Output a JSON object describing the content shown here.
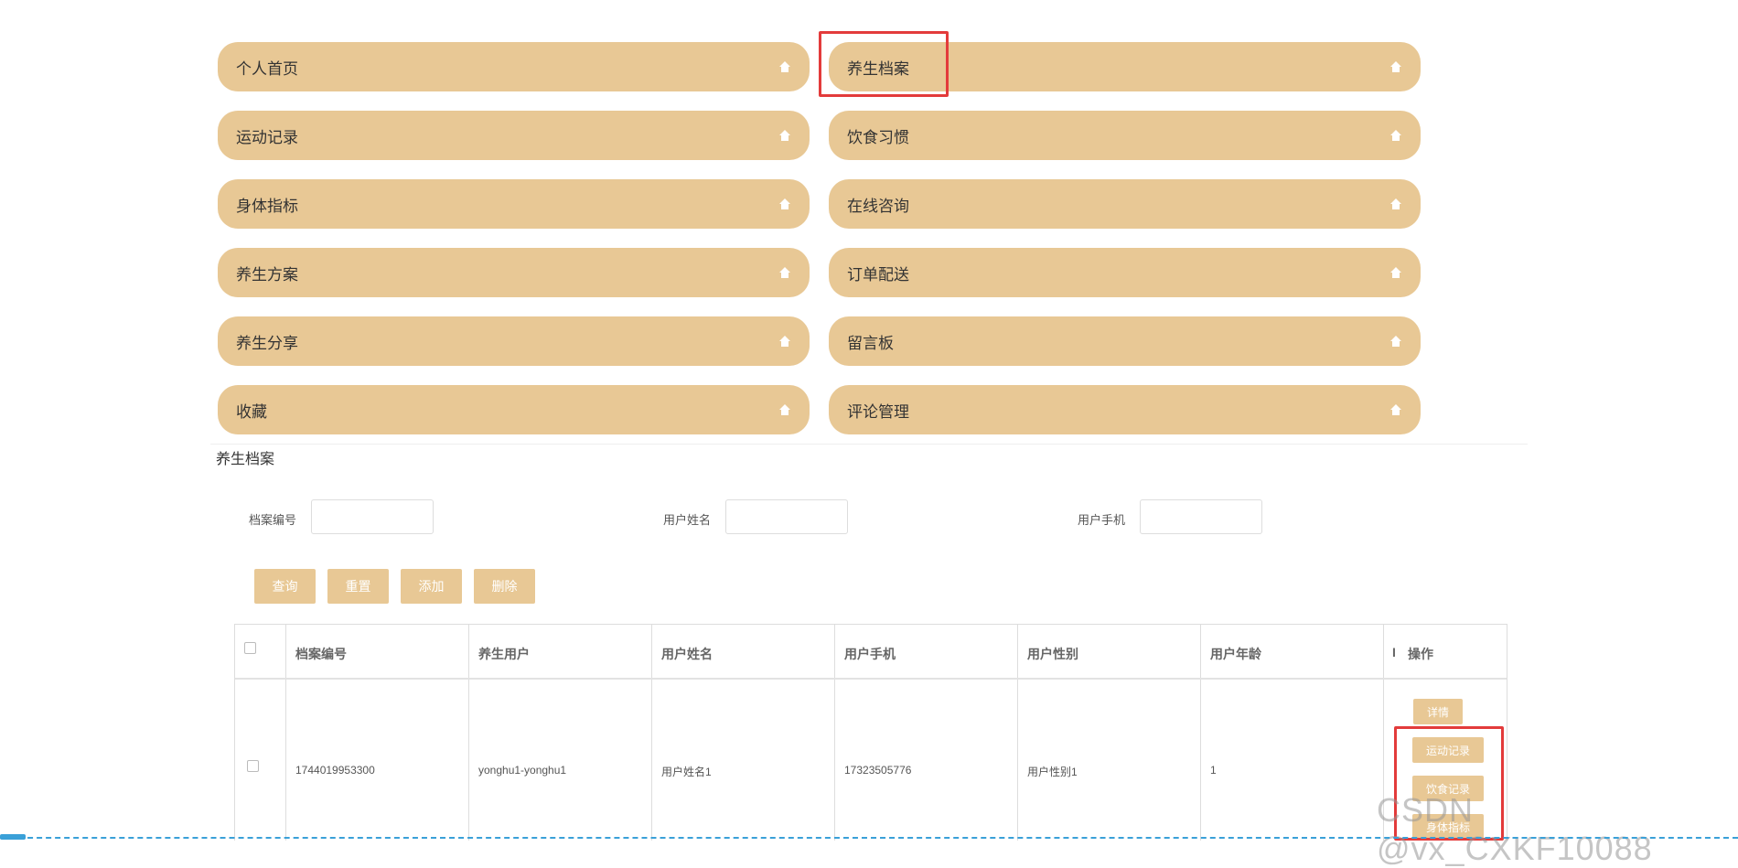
{
  "menu": {
    "items": [
      {
        "label": "个人首页",
        "icon": "home-icon"
      },
      {
        "label": "养生档案",
        "icon": "home-icon"
      },
      {
        "label": "运动记录",
        "icon": "home-icon"
      },
      {
        "label": "饮食习惯",
        "icon": "home-icon"
      },
      {
        "label": "身体指标",
        "icon": "home-icon"
      },
      {
        "label": "在线咨询",
        "icon": "home-icon"
      },
      {
        "label": "养生方案",
        "icon": "home-icon"
      },
      {
        "label": "订单配送",
        "icon": "home-icon"
      },
      {
        "label": "养生分享",
        "icon": "home-icon"
      },
      {
        "label": "留言板",
        "icon": "home-icon"
      },
      {
        "label": "收藏",
        "icon": "home-icon"
      },
      {
        "label": "评论管理",
        "icon": "home-icon"
      }
    ]
  },
  "section": {
    "title": "养生档案"
  },
  "search": {
    "archive_no_label": "档案编号",
    "username_label": "用户姓名",
    "phone_label": "用户手机",
    "archive_no_value": "",
    "username_value": "",
    "phone_value": ""
  },
  "actions": {
    "query": "查询",
    "reset": "重置",
    "add": "添加",
    "delete": "删除"
  },
  "table": {
    "headers": [
      "档案编号",
      "养生用户",
      "用户姓名",
      "用户手机",
      "用户性别",
      "用户年龄",
      "I",
      "操作"
    ],
    "rows": [
      {
        "archive_no": "1744019953300",
        "user": "yonghu1-yonghu1",
        "name": "用户姓名1",
        "phone": "17323505776",
        "gender": "用户性别1",
        "age": "1",
        "ops": [
          "详情",
          "运动记录",
          "饮食记录",
          "身体指标"
        ]
      }
    ]
  },
  "watermark": "CSDN @vx_CXKF10088",
  "colors": {
    "accent": "#e8c895",
    "highlight": "#e33b3b",
    "scroll": "#3aa0d8"
  }
}
